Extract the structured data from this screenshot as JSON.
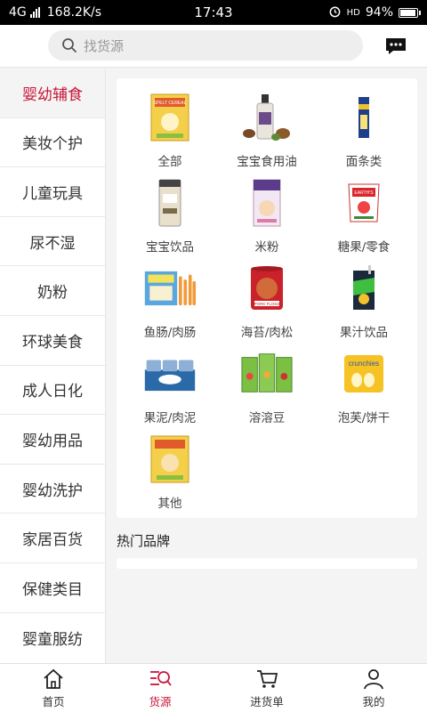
{
  "status_bar": {
    "network": "4G",
    "speed": "168.2K/s",
    "time": "17:43",
    "vowifi": "HD",
    "battery": "94%"
  },
  "header": {
    "search_placeholder": "找货源",
    "icons": {
      "search": "search-icon",
      "message": "message-icon"
    }
  },
  "sidebar": {
    "items": [
      {
        "label": "婴幼辅食",
        "active": true
      },
      {
        "label": "美妆个护"
      },
      {
        "label": "儿童玩具"
      },
      {
        "label": "尿不湿"
      },
      {
        "label": "奶粉"
      },
      {
        "label": "环球美食"
      },
      {
        "label": "成人日化"
      },
      {
        "label": "婴幼用品"
      },
      {
        "label": "婴幼洗护"
      },
      {
        "label": "家居百货"
      },
      {
        "label": "保健类目"
      },
      {
        "label": "婴童服纺"
      }
    ]
  },
  "categories": [
    {
      "label": "全部"
    },
    {
      "label": "宝宝食用油"
    },
    {
      "label": "面条类"
    },
    {
      "label": "宝宝饮品"
    },
    {
      "label": "米粉"
    },
    {
      "label": "糖果/零食"
    },
    {
      "label": "鱼肠/肉肠"
    },
    {
      "label": "海苔/肉松"
    },
    {
      "label": "果汁饮品"
    },
    {
      "label": "果泥/肉泥"
    },
    {
      "label": "溶溶豆"
    },
    {
      "label": "泡芙/饼干"
    },
    {
      "label": "其他"
    }
  ],
  "product_text": {
    "cereal_box": "SPELT CEREAL",
    "pork_floss": "PORK FLOSS",
    "crunchies": "crunchies",
    "earths_best": "EARTH'S"
  },
  "hot_brands": {
    "title": "热门品牌"
  },
  "tabbar": {
    "items": [
      {
        "label": "首页",
        "icon": "home-icon"
      },
      {
        "label": "货源",
        "icon": "source-icon",
        "active": true
      },
      {
        "label": "进货单",
        "icon": "cart-icon"
      },
      {
        "label": "我的",
        "icon": "user-icon"
      }
    ]
  },
  "colors": {
    "accent": "#c8173a",
    "background": "#f4f4f4"
  }
}
